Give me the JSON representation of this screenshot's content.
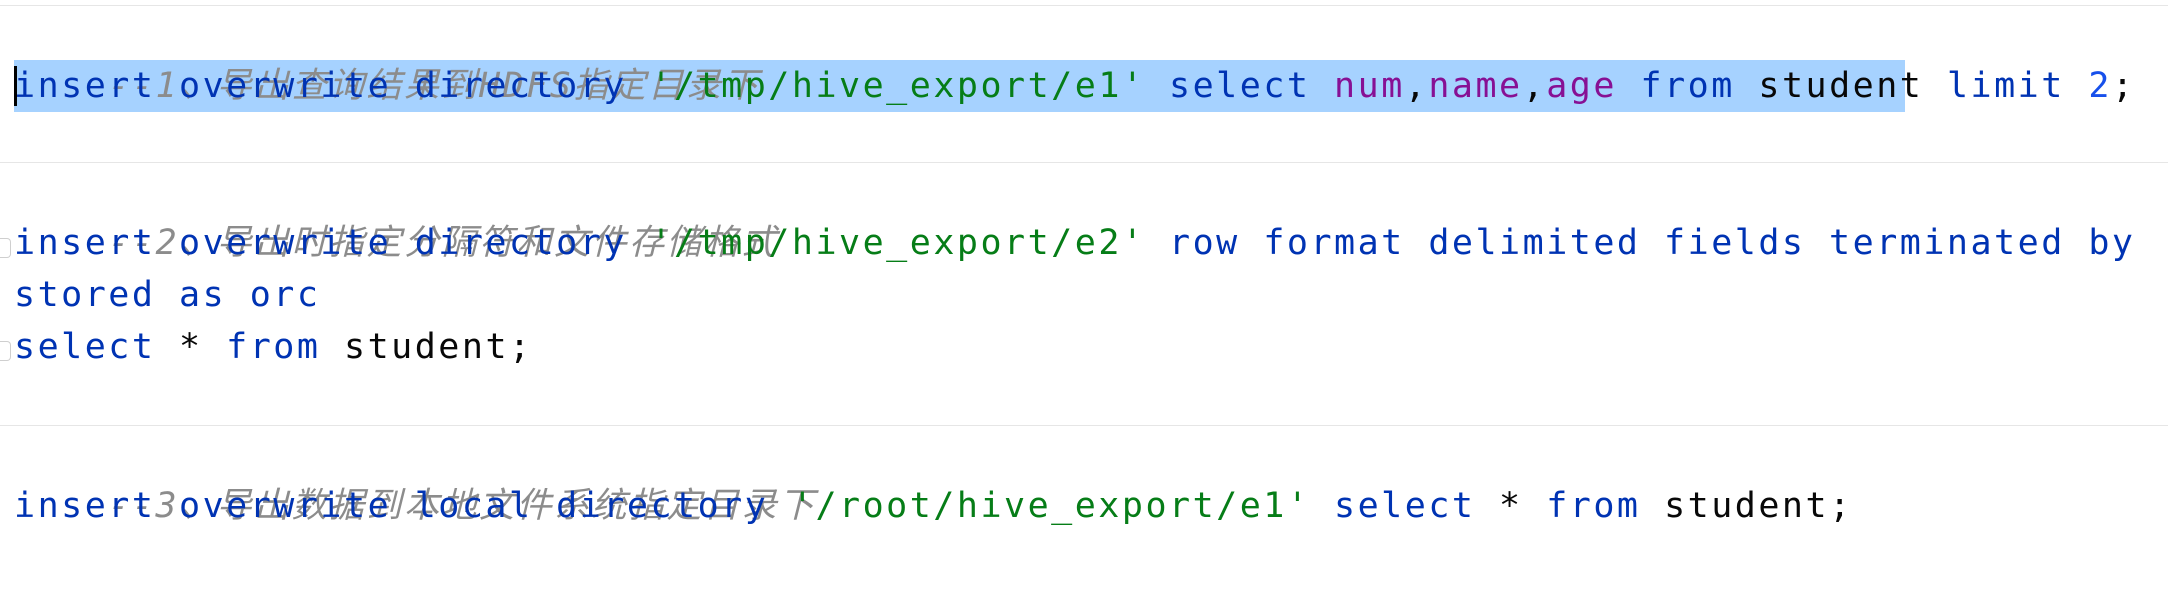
{
  "editor": {
    "colors": {
      "background": "#ffffff",
      "selection": "#a6d2ff",
      "comment": "#8c8c8c",
      "keyword": "#0033b3",
      "string": "#067d17",
      "field": "#871094",
      "number": "#1750eb",
      "text": "#080808"
    },
    "lines": {
      "l1": {
        "comment": "--1、导出查询结果到HDFS指定目录下"
      },
      "l2": {
        "kw1": "insert overwrite directory ",
        "str1": "'/tmp/hive_export/e1'",
        "kw2": " select ",
        "f1": "num",
        "p1": ",",
        "f2": "name",
        "p2": ",",
        "f3": "age",
        "kw3": " from ",
        "t1": "student",
        "kw4": " limit ",
        "num1": "2",
        "p3": ";"
      },
      "l4": {
        "comment": "--2、导出时指定分隔符和文件存储格式"
      },
      "l5": {
        "kw1": "insert overwrite directory ",
        "str1": "'/tmp/hive_export/e2'",
        "kw2": " row format delimited fields terminated by ",
        "str2": "','"
      },
      "l6": {
        "kw1": "stored as orc"
      },
      "l7": {
        "kw1": "select",
        "t1": " * ",
        "kw2": "from",
        "t2": " student;"
      },
      "l9": {
        "comment": "--3、导出数据到本地文件系统指定目录下"
      },
      "l10": {
        "kw1": "insert overwrite local directory ",
        "str1": "'/root/hive_export/e1'",
        "kw2": " select",
        "t1": " * ",
        "kw3": "from",
        "t2": " student;"
      }
    }
  }
}
